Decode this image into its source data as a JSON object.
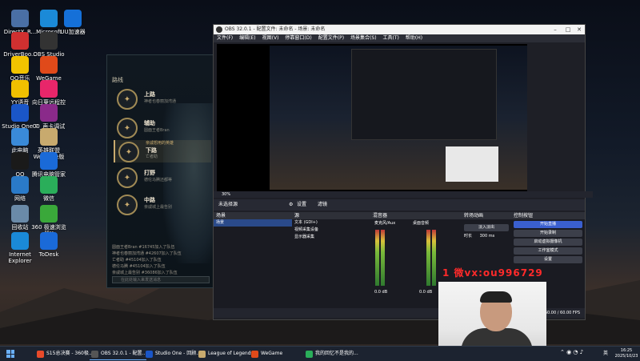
{
  "desktop_icons": [
    {
      "label": "DirectX_R...",
      "icon": "directx-icon",
      "color": "#4a6fa5"
    },
    {
      "label": "Microsoft Edge",
      "icon": "edge-icon",
      "color": "#1b8ad8"
    },
    {
      "label": "UU加速器",
      "icon": "uu-icon",
      "color": "#1570d8"
    },
    {
      "label": "DriverBoo...",
      "icon": "driverbooster-icon",
      "color": "#d03030"
    },
    {
      "label": "OBS Studio",
      "icon": "obs-icon",
      "color": "#333333"
    },
    {
      "label": "QQ音乐",
      "icon": "qqmusic-icon",
      "color": "#f2c300"
    },
    {
      "label": "WeGame",
      "icon": "wegame-icon",
      "color": "#e04a1a"
    },
    {
      "label": "YY语音",
      "icon": "yy-icon",
      "color": "#f0c000"
    },
    {
      "label": "向日葵远程控制",
      "icon": "sunlogin-icon",
      "color": "#e8266a"
    },
    {
      "label": "Studio One 7",
      "icon": "studioone-icon",
      "color": "#1a56c8"
    },
    {
      "label": "00_声卡调试调音...",
      "icon": "winrar-icon",
      "color": "#8a2a8a"
    },
    {
      "label": "此电脑",
      "icon": "computer-icon",
      "color": "#3a8ad8"
    },
    {
      "label": "英雄联盟WeGame版",
      "icon": "lol-icon",
      "color": "#c8aa6e"
    },
    {
      "label": "QQ",
      "icon": "qq-icon",
      "color": "#1a1a1a"
    },
    {
      "label": "腾讯电脑管家",
      "icon": "pcmanager-icon",
      "color": "#1a6ad8"
    },
    {
      "label": "网络",
      "icon": "network-icon",
      "color": "#2a7ac8"
    },
    {
      "label": "微信",
      "icon": "wechat-icon",
      "color": "#2aae5a"
    },
    {
      "label": "回收站",
      "icon": "recycle-bin-icon",
      "color": "#6a8aa8"
    },
    {
      "label": "360 极速浏览器X",
      "icon": "360-icon",
      "color": "#3aa83a"
    },
    {
      "label": "Internet Explorer",
      "icon": "ie-icon",
      "color": "#1a8ad8"
    },
    {
      "label": "ToDesk",
      "icon": "todesk-icon",
      "color": "#1a6ad8"
    }
  ],
  "lol": {
    "header": "路线",
    "roles": [
      {
        "name": "上路",
        "desc": "神者也春丽加湾通",
        "icon": "top-lane-icon"
      },
      {
        "name": "辅助",
        "desc": "圆面王者Bran",
        "icon": "support-icon"
      },
      {
        "name": "下路",
        "desc": "亡者助",
        "pre": "亲戚想用的英雄",
        "icon": "bot-lane-icon"
      },
      {
        "name": "打野",
        "desc": "德伦马腾还都等",
        "icon": "jungle-icon"
      },
      {
        "name": "中路",
        "desc": "亲戚城上最告别",
        "icon": "mid-lane-icon"
      }
    ],
    "chat": [
      "圆面王者Bran #16745加入了队伍",
      "神者也春丽加湾通 #42607加入了队伍",
      "亡者助 #45104加入了队伍",
      "德伦马腾 #45104加入了队伍",
      "亲戚城上最告别 #36086加入了队伍"
    ],
    "chat_placeholder": "在此处输入来发送消息"
  },
  "obs": {
    "title": "OBS 32.0.1 - 配置文件: 未命名 - 场景: 未命名",
    "menu": [
      "文件(F)",
      "编辑(E)",
      "视图(V)",
      "停靠窗口(D)",
      "配置文件(P)",
      "场景集合(S)",
      "工具(T)",
      "帮助(H)"
    ],
    "zoom": "30%",
    "not_selected": "未选择源",
    "props_btn": "设置",
    "filters_btn": "滤镜",
    "docks": {
      "scenes": {
        "title": "场景",
        "items": [
          "场景"
        ]
      },
      "sources": {
        "title": "源",
        "items": [
          "文本 (GDI+)",
          "视频采集设备",
          "显示器采集"
        ]
      },
      "mixer": {
        "title": "混音器",
        "channels": [
          "麦克风/Aux",
          "桌面音频"
        ],
        "db": [
          "0.0 dB",
          "0.0 dB"
        ]
      },
      "transitions": {
        "title": "转场动画",
        "type": "淡入淡出",
        "duration_label": "时长",
        "duration": "300 ms"
      },
      "controls": {
        "title": "控制按钮",
        "buttons": [
          "开始直播",
          "开始录制",
          "启动虚拟摄像机",
          "工作室模式",
          "设置"
        ]
      }
    },
    "status": "帧 00:00:00 · 0.0% · 60.00 / 60.00 FPS"
  },
  "watermark": "1 微vx:ou996729",
  "taskbar": {
    "items": [
      {
        "label": "S15总决赛 - 360极...",
        "icon": "chrome-icon",
        "color": "#e84a2a"
      },
      {
        "label": "OBS 32.0.1 - 配置...",
        "icon": "obs-icon",
        "color": "#555555"
      },
      {
        "label": "Studio One - 回顾...",
        "icon": "studioone-icon",
        "color": "#1a56c8"
      },
      {
        "label": "League of Legends",
        "icon": "lol-icon",
        "color": "#c8aa6e"
      },
      {
        "label": "WeGame",
        "icon": "wegame-icon",
        "color": "#e04a1a"
      },
      {
        "label": "我的回忆不是我的...",
        "icon": "music-icon",
        "color": "#2aae5a"
      }
    ],
    "lang": "英",
    "time": "16:25",
    "date": "2025/10/23"
  }
}
